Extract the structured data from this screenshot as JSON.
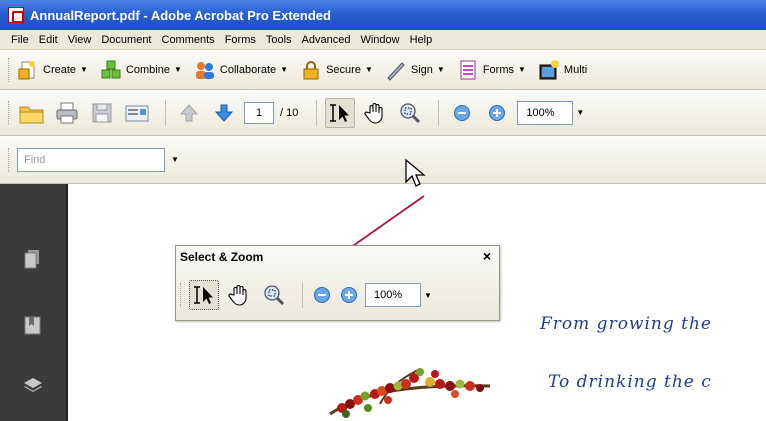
{
  "window": {
    "title": "AnnualReport.pdf - Adobe Acrobat Pro Extended"
  },
  "menubar": {
    "items": [
      "File",
      "Edit",
      "View",
      "Document",
      "Comments",
      "Forms",
      "Tools",
      "Advanced",
      "Window",
      "Help"
    ]
  },
  "task_toolbar": {
    "buttons": [
      {
        "label": "Create",
        "icon": "create-icon"
      },
      {
        "label": "Combine",
        "icon": "combine-icon"
      },
      {
        "label": "Collaborate",
        "icon": "collaborate-icon"
      },
      {
        "label": "Secure",
        "icon": "lock-icon"
      },
      {
        "label": "Sign",
        "icon": "pen-icon"
      },
      {
        "label": "Forms",
        "icon": "forms-icon"
      },
      {
        "label": "Multi",
        "icon": "multimedia-icon"
      }
    ]
  },
  "nav_toolbar": {
    "page_current": "1",
    "page_total": "/ 10",
    "zoom": "100%"
  },
  "find": {
    "placeholder": "Find"
  },
  "select_zoom_panel": {
    "title": "Select & Zoom",
    "close": "×",
    "zoom": "100%"
  },
  "document": {
    "line1": "From growing the",
    "line2": "To drinking the c"
  },
  "colors": {
    "titlebar": "#2a5fd0",
    "toolbar": "#ece9d8",
    "nav_panel": "#3b3b3b",
    "doc_text": "#1f3f8a",
    "callout_arrow": "#b3123f"
  }
}
